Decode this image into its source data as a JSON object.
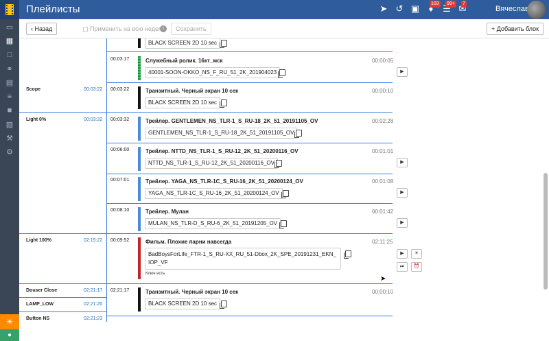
{
  "header": {
    "title": "Плейлисты",
    "badges": {
      "notifications": "103",
      "tasks": "99+",
      "messages": "7"
    },
    "user": "Вячеслав"
  },
  "toolbar": {
    "back": "Назад",
    "apply_week": "Применить на всю неделю",
    "save": "Сохранить",
    "add_block": "Добавить блок"
  },
  "blocks": [
    {
      "name": "Scope",
      "time": "00:03:22"
    },
    {
      "name": "Light 0%",
      "time": "00:03:32"
    },
    {
      "name": "Light 100%",
      "time": "02:15:22"
    },
    {
      "name": "Douser Close",
      "time": "02:21:17"
    },
    {
      "name": "LAMP_LOW",
      "time": "02:21:20"
    },
    {
      "name": "Button NS",
      "time": "02:21:23"
    }
  ],
  "events": [
    {
      "start": "",
      "name": "",
      "duration": "",
      "file": "BLACK SCREEN 2D 10 sec"
    },
    {
      "start": "00:03:17",
      "name": "Служебный ролик. 16кт_мск",
      "duration": "00:00:05",
      "file": "40001-SOON-OKKO_NS_F_RU_51_2K_201904023"
    },
    {
      "start": "00:03:22",
      "name": "Транзитный. Черный экран 10 сек",
      "duration": "00:00:10",
      "file": "BLACK SCREEN 2D 10 sec"
    },
    {
      "start": "00:03:32",
      "name": "Трейлер. GENTLEMEN_NS_TLR-1_S_RU-18_2K_51_20191105_OV",
      "duration": "00:02:28",
      "file": "GENTLEMEN_NS_TLR-1_S_RU-18_2K_51_20191105_OV"
    },
    {
      "start": "00:06:00",
      "name": "Трейлер. NTTD_NS_TLR-1_S_RU-12_2K_51_20200116_OV",
      "duration": "00:01:01",
      "file": "NTTD_NS_TLR-1_S_RU-12_2K_51_20200116_OV"
    },
    {
      "start": "00:07:01",
      "name": "Трейлер. YAGA_NS_TLR-1C_S_RU-16_2K_51_20200124_OV",
      "duration": "00:01:08",
      "file": "YAGA_NS_TLR-1C_S_RU-16_2K_51_20200124_OV"
    },
    {
      "start": "00:08:10",
      "name": "Трейлер. Мулан",
      "duration": "00:01:42",
      "file": "MULAN_NS_TLR-D_S_RU-6_2K_51_20191205_OV"
    },
    {
      "start": "00:09:52",
      "name": "Фильм. Плохие парни навсегда",
      "duration": "02:11:25",
      "file": "BadBoysForLife_FTR-1_S_RU-XX_RU_51-Dbox_2K_SPE_20191231_EKN_IOP_VF",
      "note": "Ключ есть"
    },
    {
      "start": "02:21:17",
      "name": "Транзитный. Черный экран 10 сек",
      "duration": "00:00:10",
      "file": "BLACK SCREEN 2D 10 sec"
    }
  ]
}
